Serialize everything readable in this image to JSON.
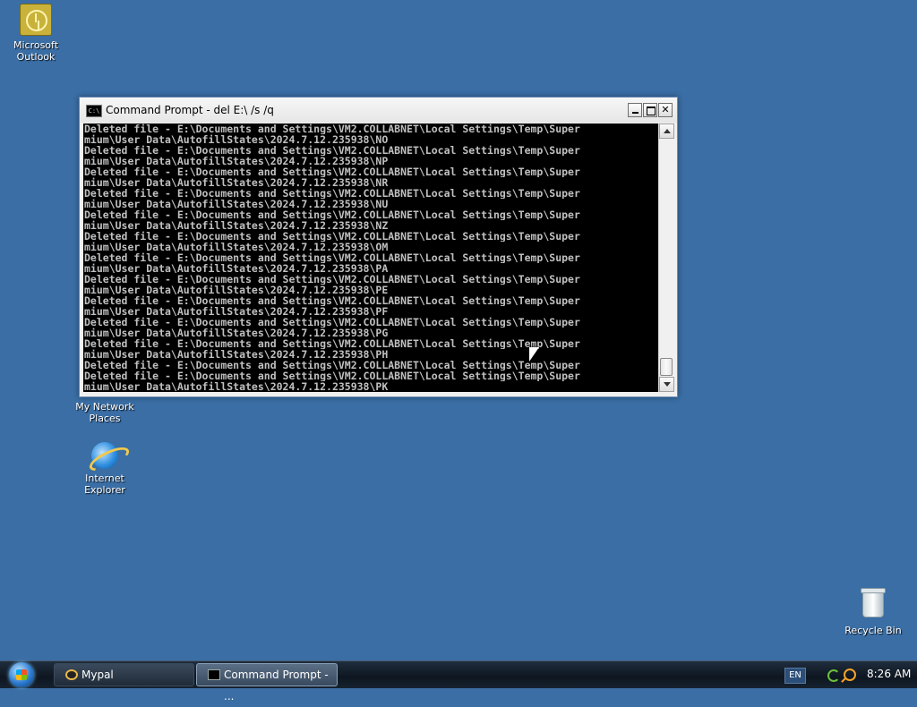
{
  "desktop": {
    "icons": {
      "outlook": "Microsoft Outlook",
      "network": "My Network Places",
      "ie": "Internet Explorer",
      "recycle": "Recycle Bin"
    }
  },
  "window": {
    "title": "Command Prompt - del E:\\ /s /q",
    "icon": "cmd-icon",
    "buttons": [
      "minimize",
      "maximize",
      "close"
    ]
  },
  "console": {
    "lines": [
      "Deleted file - E:\\Documents and Settings\\VM2.COLLABNET\\Local Settings\\Temp\\Super",
      "mium\\User Data\\AutofillStates\\2024.7.12.235938\\NO",
      "Deleted file - E:\\Documents and Settings\\VM2.COLLABNET\\Local Settings\\Temp\\Super",
      "mium\\User Data\\AutofillStates\\2024.7.12.235938\\NP",
      "Deleted file - E:\\Documents and Settings\\VM2.COLLABNET\\Local Settings\\Temp\\Super",
      "mium\\User Data\\AutofillStates\\2024.7.12.235938\\NR",
      "Deleted file - E:\\Documents and Settings\\VM2.COLLABNET\\Local Settings\\Temp\\Super",
      "mium\\User Data\\AutofillStates\\2024.7.12.235938\\NU",
      "Deleted file - E:\\Documents and Settings\\VM2.COLLABNET\\Local Settings\\Temp\\Super",
      "mium\\User Data\\AutofillStates\\2024.7.12.235938\\NZ",
      "Deleted file - E:\\Documents and Settings\\VM2.COLLABNET\\Local Settings\\Temp\\Super",
      "mium\\User Data\\AutofillStates\\2024.7.12.235938\\OM",
      "Deleted file - E:\\Documents and Settings\\VM2.COLLABNET\\Local Settings\\Temp\\Super",
      "mium\\User Data\\AutofillStates\\2024.7.12.235938\\PA",
      "Deleted file - E:\\Documents and Settings\\VM2.COLLABNET\\Local Settings\\Temp\\Super",
      "mium\\User Data\\AutofillStates\\2024.7.12.235938\\PE",
      "Deleted file - E:\\Documents and Settings\\VM2.COLLABNET\\Local Settings\\Temp\\Super",
      "mium\\User Data\\AutofillStates\\2024.7.12.235938\\PF",
      "Deleted file - E:\\Documents and Settings\\VM2.COLLABNET\\Local Settings\\Temp\\Super",
      "mium\\User Data\\AutofillStates\\2024.7.12.235938\\PG",
      "Deleted file - E:\\Documents and Settings\\VM2.COLLABNET\\Local Settings\\Temp\\Super",
      "mium\\User Data\\AutofillStates\\2024.7.12.235938\\PH",
      "Deleted file - E:\\Documents and Settings\\VM2.COLLABNET\\Local Settings\\Temp\\Super",
      "Deleted file - E:\\Documents and Settings\\VM2.COLLABNET\\Local Settings\\Temp\\Super",
      "mium\\User Data\\AutofillStates\\2024.7.12.235938\\PK"
    ],
    "text_color": "#c0c0c0",
    "background": "#000000"
  },
  "taskbar": {
    "items": [
      {
        "label": "Mypal",
        "icon": "mypal-icon"
      },
      {
        "label": "Command Prompt - ...",
        "icon": "cmd-icon"
      }
    ],
    "tray": {
      "language": "EN",
      "time": "8:26 AM"
    }
  },
  "colors": {
    "desktop": "#3a6ea5",
    "taskbar": "#0e1620"
  }
}
